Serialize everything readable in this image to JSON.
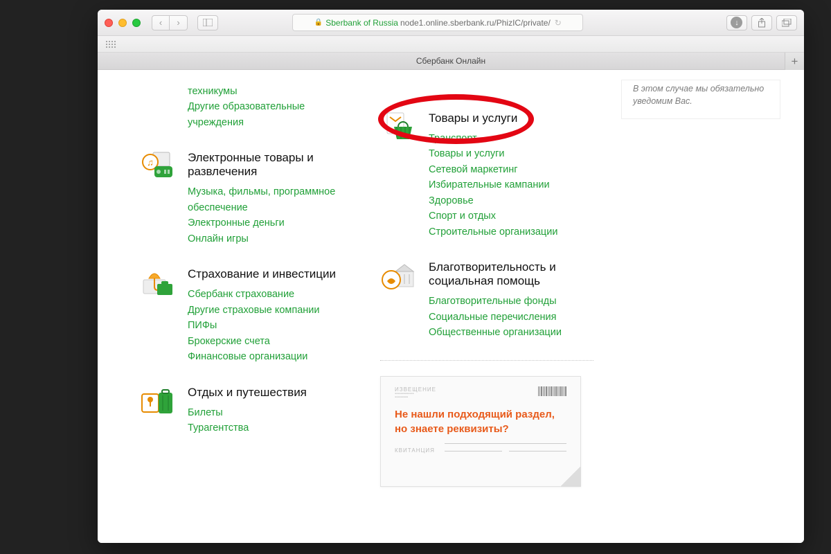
{
  "browser": {
    "site_label": "Sberbank of Russia",
    "url_path": "node1.online.sberbank.ru/PhizIC/private/",
    "tab_title": "Сбербанк Онлайн"
  },
  "left_column": {
    "orphan_links": [
      "техникумы",
      "Другие образовательные учреждения"
    ],
    "categories": [
      {
        "id": "entertainment",
        "title": "Электронные товары и развлечения",
        "links": [
          "Музыка, фильмы, программное обеспечение",
          "Электронные деньги",
          "Онлайн игры"
        ]
      },
      {
        "id": "insurance",
        "title": "Страхование и инвестиции",
        "links": [
          "Сбербанк страхование",
          "Другие страховые компании",
          "ПИФы",
          "Брокерские счета",
          "Финансовые организации"
        ]
      },
      {
        "id": "travel",
        "title": "Отдых и путешествия",
        "links": [
          "Билеты",
          "Турагентства"
        ]
      }
    ]
  },
  "right_column": {
    "categories": [
      {
        "id": "goods",
        "title": "Товары и услуги",
        "links": [
          "Транспорт",
          "Товары и услуги",
          "Сетевой маркетинг",
          "Избирательные кампании",
          "Здоровье",
          "Спорт и отдых",
          "Строительные организации"
        ]
      },
      {
        "id": "charity",
        "title": "Благотворительность и социальная помощь",
        "links": [
          "Благотворительные фонды",
          "Социальные перечисления",
          "Общественные организации"
        ]
      }
    ],
    "receipt_title": "Не нашли подходящий раздел, но знаете реквизиты?"
  },
  "sidebar_notice": "В этом случае мы обязательно уведомим Вас."
}
